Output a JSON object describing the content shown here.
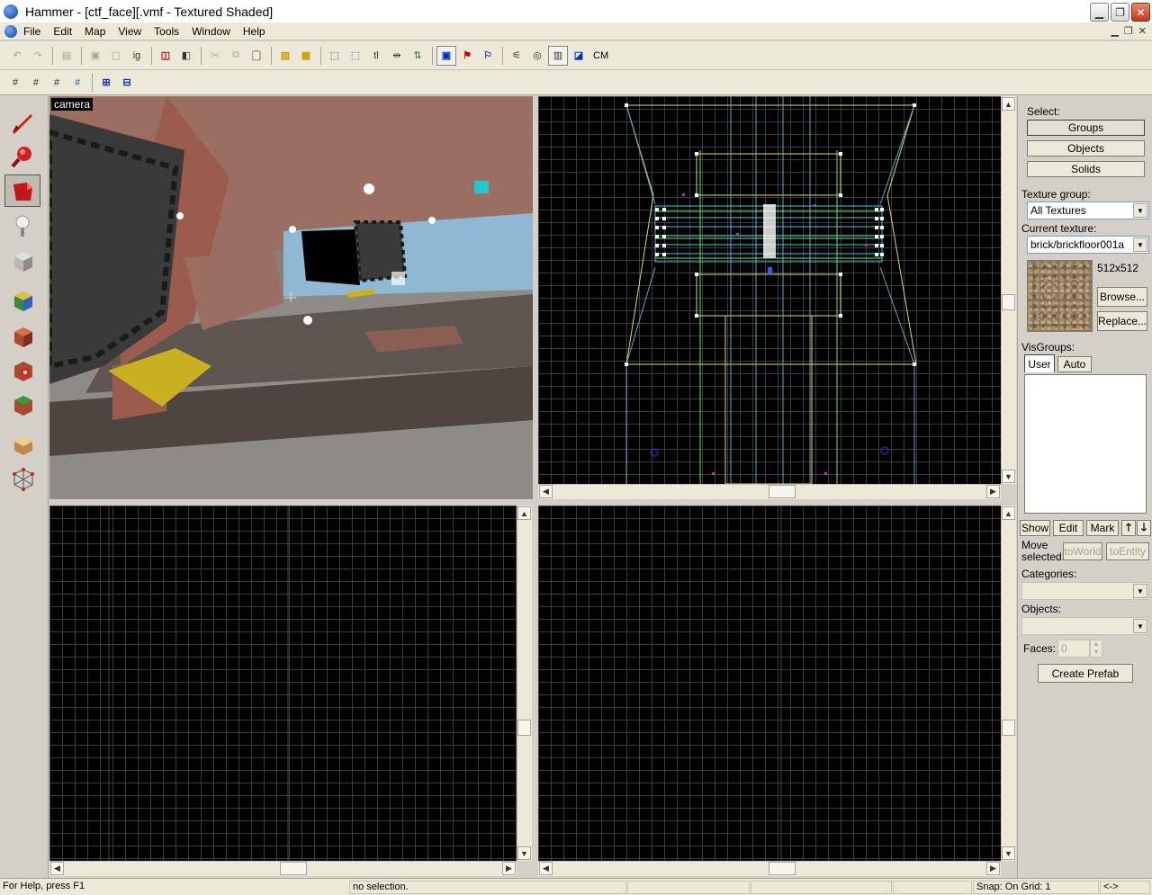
{
  "window": {
    "title": "Hammer - [ctf_face][.vmf - Textured Shaded]",
    "minimize_label": "▁",
    "restore_label": "❐",
    "close_label": "✕"
  },
  "menu": {
    "items": [
      "File",
      "Edit",
      "Map",
      "View",
      "Tools",
      "Window",
      "Help"
    ]
  },
  "toolbar": {
    "tl_label": "tl",
    "cm_label": "CM",
    "ig_label": "ig"
  },
  "viewports": {
    "camera_label": "camera"
  },
  "right_panel": {
    "select_label": "Select:",
    "groups_button": "Groups",
    "objects_button": "Objects",
    "solids_button": "Solids",
    "texture_group_label": "Texture group:",
    "texture_group_value": "All Textures",
    "current_texture_label": "Current texture:",
    "current_texture_value": "brick/brickfloor001a",
    "texture_size": "512x512",
    "browse_button": "Browse...",
    "replace_button": "Replace...",
    "visgroups_label": "VisGroups:",
    "tab_user": "User",
    "tab_auto": "Auto",
    "show_button": "Show",
    "edit_button": "Edit",
    "mark_button": "Mark",
    "move_selected_label": "Move selected:",
    "to_world_button": "toWorld",
    "to_entity_button": "toEntity",
    "categories_label": "Categories:",
    "objects_label": "Objects:",
    "faces_label": "Faces:",
    "faces_value": "0",
    "create_prefab_button": "Create Prefab"
  },
  "status": {
    "help": "For Help, press F1",
    "selection": "no selection.",
    "snap": "Snap: On Grid: 1",
    "arrows": "<->"
  }
}
